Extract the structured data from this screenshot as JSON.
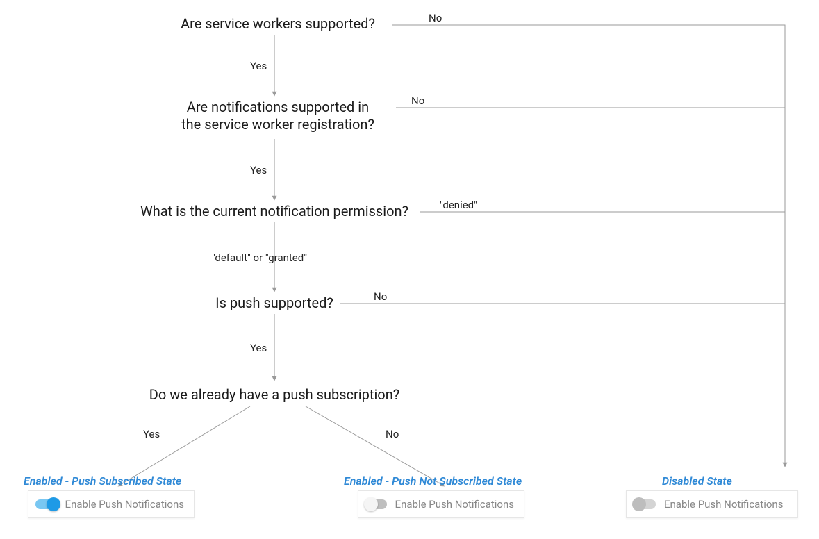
{
  "nodes": {
    "q1": "Are service workers supported?",
    "q2": "Are notifications supported in\nthe service worker registration?",
    "q3": "What is the current notification permission?",
    "q4": "Is push supported?",
    "q5": "Do we already have a push subscription?"
  },
  "edges": {
    "yes": "Yes",
    "no": "No",
    "denied": "\"denied\"",
    "default_or_granted": "\"default\" or \"granted\""
  },
  "states": {
    "subscribed": {
      "title": "Enabled - Push Subscribed State",
      "card": "Enable Push Notifications"
    },
    "not_subscribed": {
      "title": "Enabled - Push Not Subscribed State",
      "card": "Enable Push Notifications"
    },
    "disabled": {
      "title": "Disabled State",
      "card": "Enable Push Notifications"
    }
  },
  "chart_data": {
    "type": "other",
    "subtype": "decision-flowchart",
    "nodes": [
      {
        "id": "q1",
        "text": "Are service workers supported?",
        "edges": [
          {
            "label": "Yes",
            "to": "q2"
          },
          {
            "label": "No",
            "to": "disabled"
          }
        ]
      },
      {
        "id": "q2",
        "text": "Are notifications supported in the service worker registration?",
        "edges": [
          {
            "label": "Yes",
            "to": "q3"
          },
          {
            "label": "No",
            "to": "disabled"
          }
        ]
      },
      {
        "id": "q3",
        "text": "What is the current notification permission?",
        "edges": [
          {
            "label": "\"default\" or \"granted\"",
            "to": "q4"
          },
          {
            "label": "\"denied\"",
            "to": "disabled"
          }
        ]
      },
      {
        "id": "q4",
        "text": "Is push supported?",
        "edges": [
          {
            "label": "Yes",
            "to": "q5"
          },
          {
            "label": "No",
            "to": "disabled"
          }
        ]
      },
      {
        "id": "q5",
        "text": "Do we already have a push subscription?",
        "edges": [
          {
            "label": "Yes",
            "to": "subscribed"
          },
          {
            "label": "No",
            "to": "not_subscribed"
          }
        ]
      },
      {
        "id": "subscribed",
        "text": "Enabled - Push Subscribed State",
        "terminal": true,
        "toggle": "on"
      },
      {
        "id": "not_subscribed",
        "text": "Enabled - Push Not Subscribed State",
        "terminal": true,
        "toggle": "off"
      },
      {
        "id": "disabled",
        "text": "Disabled State",
        "terminal": true,
        "toggle": "disabled"
      }
    ]
  }
}
